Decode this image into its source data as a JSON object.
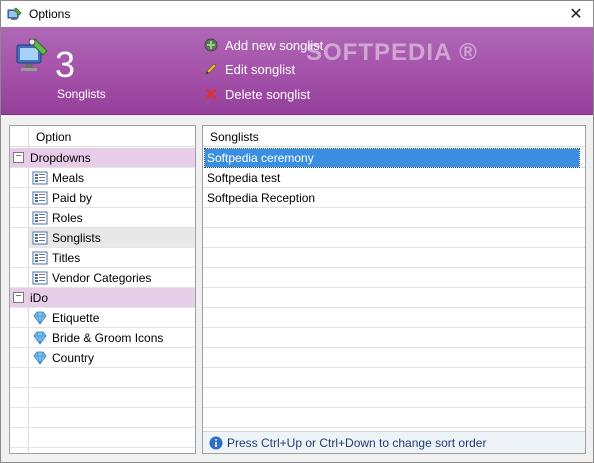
{
  "window": {
    "title": "Options",
    "close_glyph": "✕"
  },
  "banner": {
    "count": "3",
    "count_label": "Songlists",
    "watermark": "SOFTPEDIA ®",
    "actions": {
      "add": "Add new songlist",
      "edit": "Edit songlist",
      "delete": "Delete songlist"
    }
  },
  "left_panel": {
    "header": "Option",
    "groups": [
      {
        "label": "Dropdowns",
        "expander": "−",
        "items": [
          "Meals",
          "Paid by",
          "Roles",
          "Songlists",
          "Titles",
          "Vendor Categories"
        ],
        "icon": "list-icon"
      },
      {
        "label": "iDo",
        "expander": "−",
        "items": [
          "Etiquette",
          "Bride & Groom Icons",
          "Country"
        ],
        "icon": "gem-icon"
      }
    ],
    "selected_item": "Songlists"
  },
  "right_panel": {
    "header": "Songlists",
    "rows": [
      "Softpedia ceremony",
      "Softpedia test",
      "Softpedia Reception"
    ],
    "selected_row": "Softpedia ceremony",
    "footer_hint": "Press Ctrl+Up or Ctrl+Down to change sort order"
  },
  "colors": {
    "banner": "#a24fa8",
    "group_row": "#e8cde9",
    "selection": "#3c8fe0",
    "hint_text": "#1f3c72"
  }
}
